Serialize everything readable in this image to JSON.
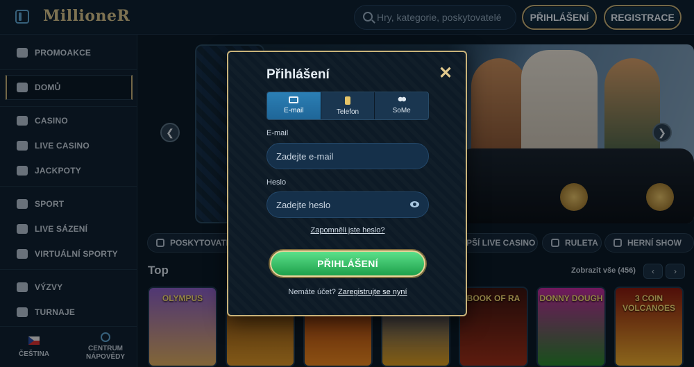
{
  "header": {
    "logo": "MillioneR",
    "search_placeholder": "Hry, kategorie, poskytovatelé",
    "login_label": "PŘIHLÁŠENÍ",
    "register_label": "REGISTRACE"
  },
  "sidebar": {
    "items": [
      {
        "label": "PROMOAKCE",
        "icon": "megaphone-icon"
      },
      {
        "label": "DOMŮ",
        "icon": "home-icon"
      },
      {
        "label": "CASINO",
        "icon": "spade-icon"
      },
      {
        "label": "LIVE CASINO",
        "icon": "live-icon"
      },
      {
        "label": "JACKPOTY",
        "icon": "jackpot-icon"
      },
      {
        "label": "SPORT",
        "icon": "ball-icon"
      },
      {
        "label": "LIVE SÁZENÍ",
        "icon": "live-bet-icon"
      },
      {
        "label": "VIRTUÁLNÍ SPORTY",
        "icon": "globe-icon"
      },
      {
        "label": "VÝZVY",
        "icon": "swords-icon"
      },
      {
        "label": "TURNAJE",
        "icon": "trophy-icon"
      }
    ],
    "language": "ČEŠTINA",
    "help_line1": "CENTRUM",
    "help_line2": "NÁPOVĚDY"
  },
  "main": {
    "category_pills": [
      "POSKYTOVATE",
      "EPŠÍ LIVE CASINO",
      "RULETA",
      "HERNÍ SHOW"
    ],
    "section_title": "Top",
    "show_all": "Zobrazit vše (456)",
    "games": [
      "OLYMPUS",
      "",
      "",
      "",
      "BOOK OF RA",
      "DONNY DOUGH",
      "3 COIN VOLCANOES"
    ]
  },
  "modal": {
    "title": "Přihlášení",
    "tabs": [
      {
        "label": "E-mail",
        "icon": "envelope-icon",
        "active": true
      },
      {
        "label": "Telefon",
        "icon": "phone-icon",
        "active": false
      },
      {
        "label": "SoMe",
        "icon": "users-icon",
        "active": false
      }
    ],
    "email_label": "E-mail",
    "email_placeholder": "Zadejte e-mail",
    "password_label": "Heslo",
    "password_placeholder": "Zadejte heslo",
    "forgot_label": "Zapomněli jste heslo?",
    "submit_label": "PŘIHLÁŠENÍ",
    "no_account_text": "Nemáte účet?",
    "register_link": "Zaregistrujte se nyní"
  },
  "colors": {
    "accent_gold": "#c9b37a",
    "submit_green": "#2fbf63",
    "tab_active": "#2b7fb5"
  }
}
